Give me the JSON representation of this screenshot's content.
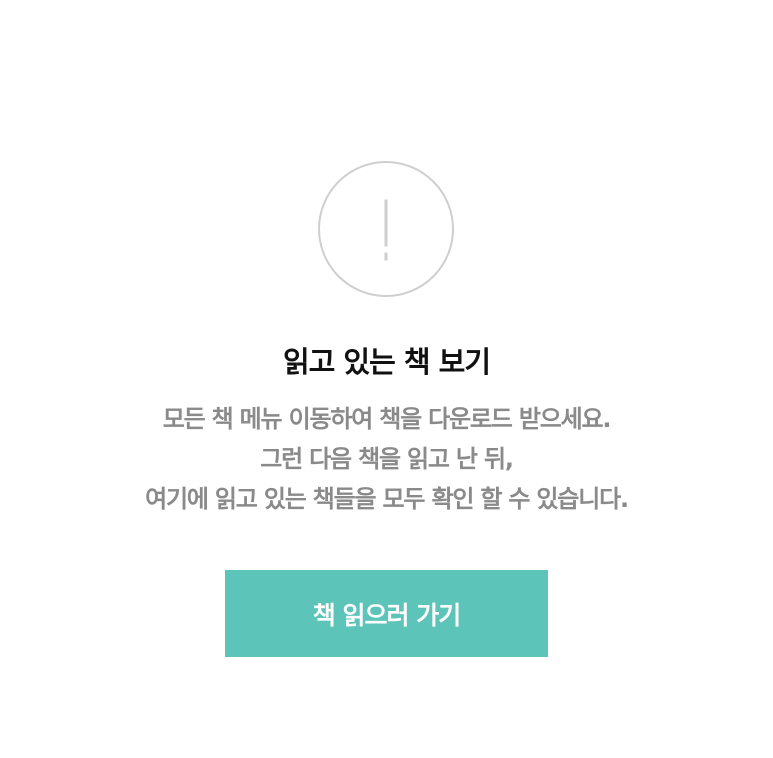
{
  "empty_state": {
    "icon": "exclamation-icon",
    "title": "읽고 있는 책 보기",
    "message_lines": [
      "모든 책 메뉴 이동하여 책을 다운로드 받으세요.",
      "그런 다음 책을 읽고 난 뒤,",
      "여기에 읽고 있는 책들을 모두 확인 할 수 있습니다."
    ],
    "button_label": "책 읽으러 가기"
  },
  "colors": {
    "accent": "#5cc4b8",
    "title": "#111111",
    "message": "#8a8a8a",
    "icon_stroke": "#cfcfcf"
  }
}
